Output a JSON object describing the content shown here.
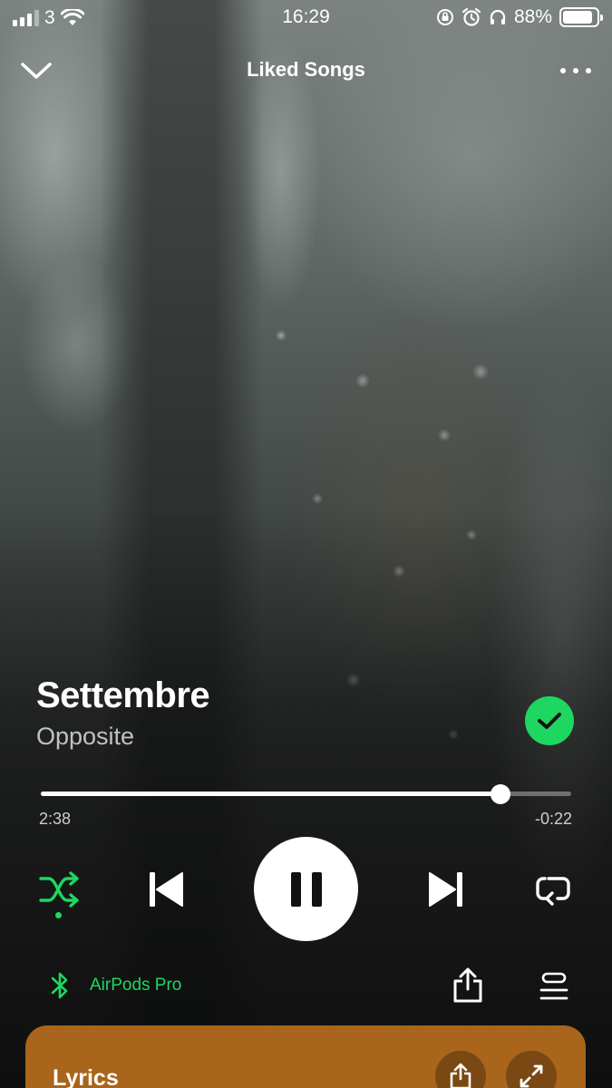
{
  "status_bar": {
    "carrier": "3",
    "time": "16:29",
    "battery_percent": "88%",
    "battery_level": 0.88,
    "signal_bars_active": 3,
    "signal_bars_total": 4,
    "icons": [
      "wifi-icon",
      "rotation-lock-icon",
      "alarm-icon",
      "headphones-icon"
    ]
  },
  "header": {
    "title": "Liked Songs",
    "left_icon": "chevron-down-icon",
    "right_icon": "more-options-icon"
  },
  "track": {
    "title": "Settembre",
    "artist": "Opposite",
    "liked": true
  },
  "playback": {
    "elapsed": "2:38",
    "remaining": "-0:22",
    "progress_fraction": 0.867,
    "is_playing": true,
    "shuffle_enabled": true,
    "repeat_enabled": false
  },
  "device": {
    "name": "AirPods Pro",
    "icon": "bluetooth-icon"
  },
  "lyrics": {
    "label": "Lyrics"
  },
  "colors": {
    "accent": "#1ed760",
    "lyrics_card": "#a8651b"
  }
}
